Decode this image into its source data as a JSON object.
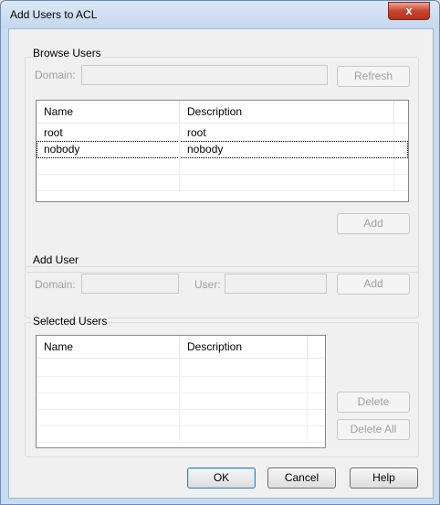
{
  "window": {
    "title": "Add Users to ACL",
    "close_label": "x"
  },
  "browse": {
    "group_label": "Browse Users",
    "domain_label": "Domain:",
    "domain_value": "",
    "refresh_label": "Refresh",
    "columns": [
      "Name",
      "Description"
    ],
    "rows": [
      {
        "name": "root",
        "description": "root"
      },
      {
        "name": "nobody",
        "description": "nobody"
      }
    ],
    "add_label": "Add"
  },
  "add_user": {
    "group_label": "Add User",
    "domain_label": "Domain:",
    "domain_value": "",
    "user_label": "User:",
    "user_value": "",
    "add_label": "Add"
  },
  "selected": {
    "group_label": "Selected Users",
    "columns": [
      "Name",
      "Description"
    ],
    "rows": [],
    "delete_label": "Delete",
    "delete_all_label": "Delete All"
  },
  "footer": {
    "ok_label": "OK",
    "cancel_label": "Cancel",
    "help_label": "Help"
  }
}
